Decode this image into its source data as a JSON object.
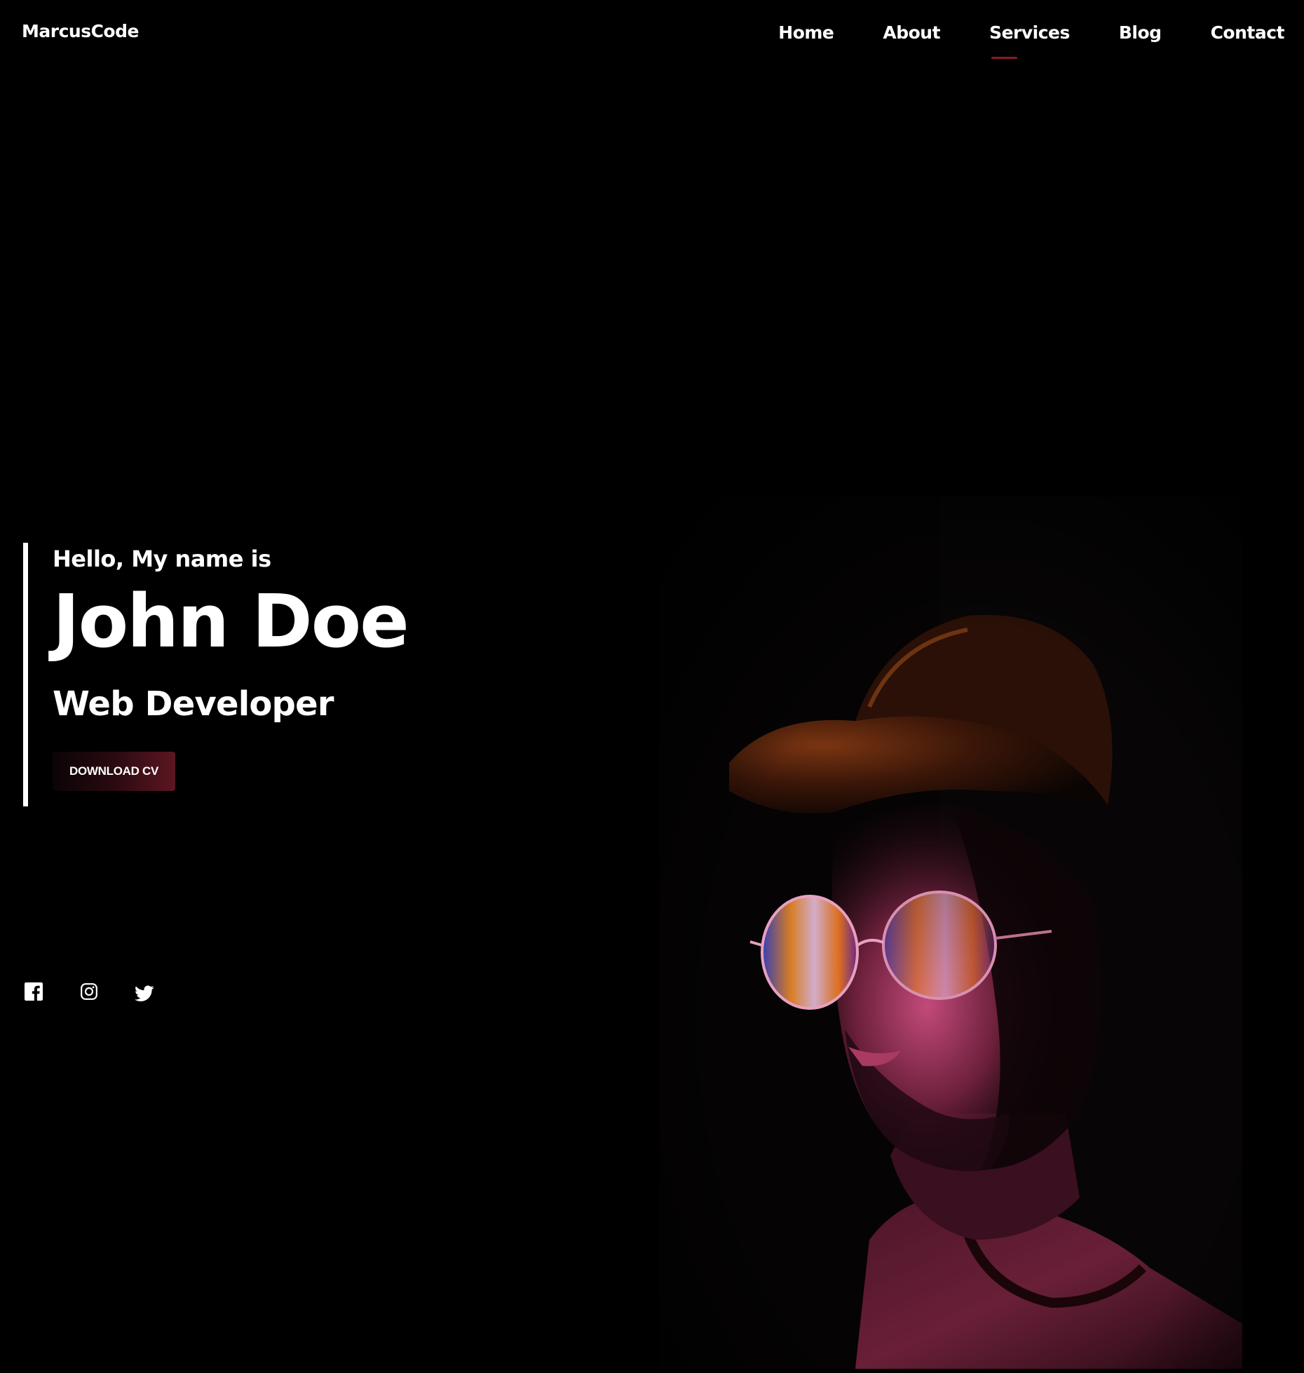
{
  "header": {
    "logo": "MarcusCode",
    "nav": [
      {
        "label": "Home"
      },
      {
        "label": "About"
      },
      {
        "label": "Services",
        "active": true
      },
      {
        "label": "Blog"
      },
      {
        "label": "Contact"
      }
    ]
  },
  "hero": {
    "greeting": "Hello, My name is",
    "name": "John Doe",
    "role": "Web Developer",
    "cv_button": "DOWNLOAD CV"
  },
  "social": [
    {
      "icon": "facebook-icon"
    },
    {
      "icon": "instagram-icon"
    },
    {
      "icon": "twitter-icon"
    }
  ],
  "colors": {
    "background": "#000000",
    "accent": "#8a1a2c",
    "text": "#ffffff"
  }
}
